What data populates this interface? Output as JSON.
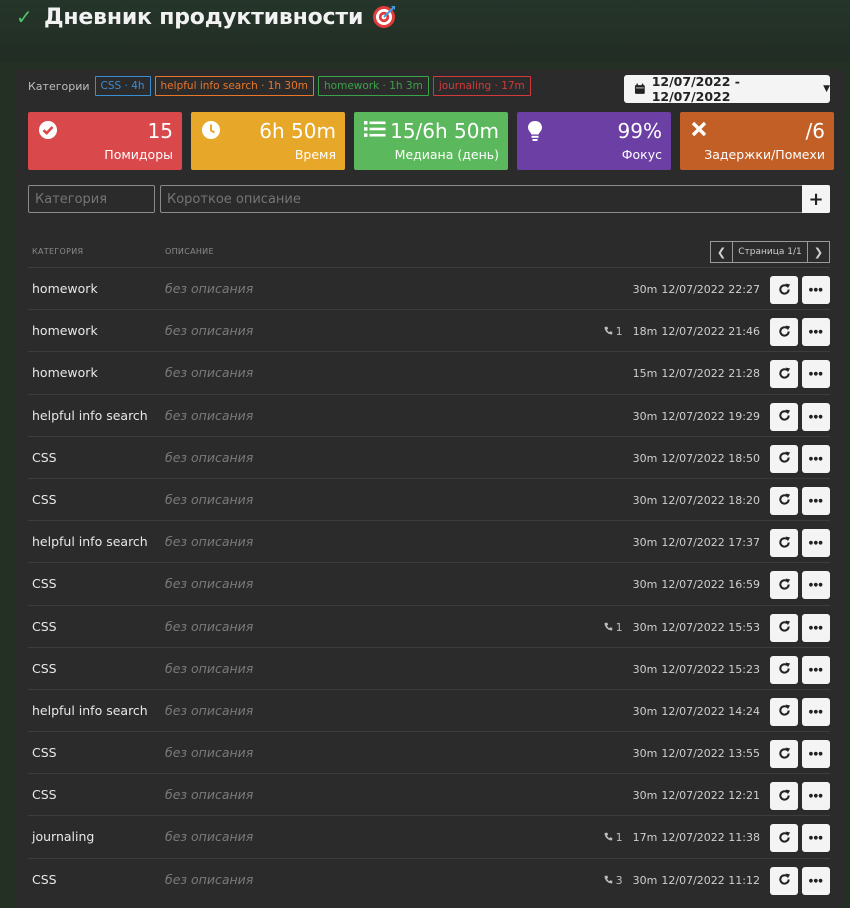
{
  "header": {
    "title": "Дневник продуктивности"
  },
  "categories_bar": {
    "label": "Категории",
    "tags": [
      {
        "text": "CSS · 4h",
        "color": "#3a8ed4"
      },
      {
        "text": "helpful info search · 1h 30m",
        "color": "#e8762a"
      },
      {
        "text": "homework · 1h 3m",
        "color": "#3aa24a"
      },
      {
        "text": "journaling · 17m",
        "color": "#d13a3a"
      }
    ]
  },
  "date_range": "12/07/2022 - 12/07/2022",
  "stats": [
    {
      "value": "15",
      "label": "Помидоры",
      "color": "#d9484a",
      "icon": "check-circle-icon"
    },
    {
      "value": "6h 50m",
      "label": "Время",
      "color": "#e7a728",
      "icon": "clock-icon"
    },
    {
      "value": "15/6h 50m",
      "label": "Медиана (день)",
      "color": "#5cb85c",
      "icon": "list-icon"
    },
    {
      "value": "99%",
      "label": "Фокус",
      "color": "#6b3fa3",
      "icon": "lightbulb-icon"
    },
    {
      "value": "/6",
      "label": "Задержки/Помехи",
      "color": "#c25f26",
      "icon": "close-icon"
    }
  ],
  "form": {
    "category_placeholder": "Категория",
    "description_placeholder": "Короткое описание",
    "add_label": "+"
  },
  "table": {
    "col_category": "КАТЕГОРИЯ",
    "col_description": "ОПИСАНИЕ",
    "page_label": "Страница 1/1",
    "rows": [
      {
        "category": "homework",
        "description": "без описания",
        "calls": "",
        "duration": "30m",
        "datetime": "12/07/2022 22:27"
      },
      {
        "category": "homework",
        "description": "без описания",
        "calls": "1",
        "duration": "18m",
        "datetime": "12/07/2022 21:46"
      },
      {
        "category": "homework",
        "description": "без описания",
        "calls": "",
        "duration": "15m",
        "datetime": "12/07/2022 21:28"
      },
      {
        "category": "helpful info search",
        "description": "без описания",
        "calls": "",
        "duration": "30m",
        "datetime": "12/07/2022 19:29"
      },
      {
        "category": "CSS",
        "description": "без описания",
        "calls": "",
        "duration": "30m",
        "datetime": "12/07/2022 18:50"
      },
      {
        "category": "CSS",
        "description": "без описания",
        "calls": "",
        "duration": "30m",
        "datetime": "12/07/2022 18:20"
      },
      {
        "category": "helpful info search",
        "description": "без описания",
        "calls": "",
        "duration": "30m",
        "datetime": "12/07/2022 17:37"
      },
      {
        "category": "CSS",
        "description": "без описания",
        "calls": "",
        "duration": "30m",
        "datetime": "12/07/2022 16:59"
      },
      {
        "category": "CSS",
        "description": "без описания",
        "calls": "1",
        "duration": "30m",
        "datetime": "12/07/2022 15:53"
      },
      {
        "category": "CSS",
        "description": "без описания",
        "calls": "",
        "duration": "30m",
        "datetime": "12/07/2022 15:23"
      },
      {
        "category": "helpful info search",
        "description": "без описания",
        "calls": "",
        "duration": "30m",
        "datetime": "12/07/2022 14:24"
      },
      {
        "category": "CSS",
        "description": "без описания",
        "calls": "",
        "duration": "30m",
        "datetime": "12/07/2022 13:55"
      },
      {
        "category": "CSS",
        "description": "без описания",
        "calls": "",
        "duration": "30m",
        "datetime": "12/07/2022 12:21"
      },
      {
        "category": "journaling",
        "description": "без описания",
        "calls": "1",
        "duration": "17m",
        "datetime": "12/07/2022 11:38"
      },
      {
        "category": "CSS",
        "description": "без описания",
        "calls": "3",
        "duration": "30m",
        "datetime": "12/07/2022 11:12"
      }
    ]
  }
}
